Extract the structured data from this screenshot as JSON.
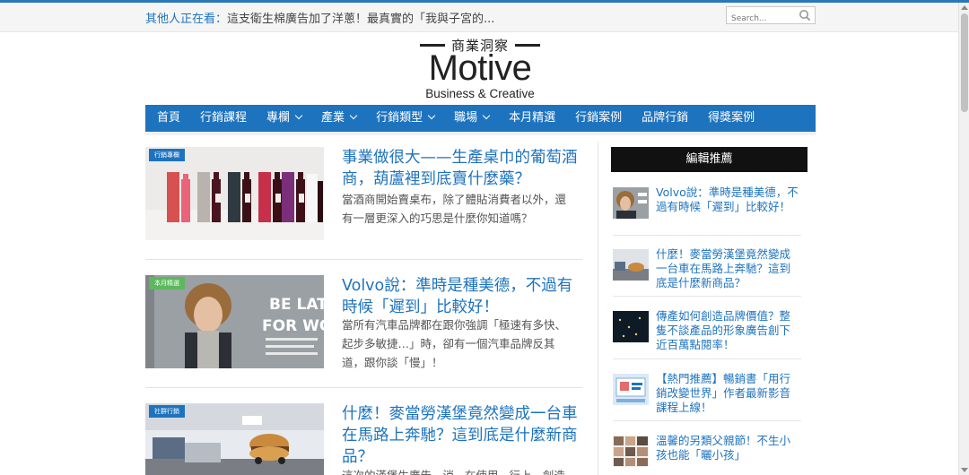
{
  "ticker": {
    "lead": "其他人正在看：",
    "text": "這支衛生棉廣告加了洋蔥！最真實的「我與子宮的..."
  },
  "search": {
    "placeholder": "Search..."
  },
  "logo": {
    "chinese": "商業洞察",
    "main": "Motive",
    "sub": "Business & Creative"
  },
  "nav": [
    {
      "label": "首頁",
      "dropdown": false
    },
    {
      "label": "行銷課程",
      "dropdown": false
    },
    {
      "label": "專欄",
      "dropdown": true
    },
    {
      "label": "產業",
      "dropdown": true
    },
    {
      "label": "行銷類型",
      "dropdown": true
    },
    {
      "label": "職場",
      "dropdown": true
    },
    {
      "label": "本月精選",
      "dropdown": false
    },
    {
      "label": "行銷案例",
      "dropdown": false
    },
    {
      "label": "品牌行銷",
      "dropdown": false
    },
    {
      "label": "得獎案例",
      "dropdown": false
    }
  ],
  "articles": [
    {
      "tag": "行銷專欄",
      "tag_color": "#1e73be",
      "title": "事業做很大——生產桌巾的葡萄酒商，葫蘆裡到底賣什麼藥？",
      "excerpt": "當酒商開始賣桌布，除了體貼消費者以外，還有一層更深入的巧思是什麼你知道嗎？"
    },
    {
      "tag": "本月精選",
      "tag_color": "#5cb85c",
      "title": "Volvo說：準時是種美德，不過有時候「遲到」比較好！",
      "excerpt": "當所有汽車品牌都在跟你強調「極速有多快、起步多敏捷…」時，卻有一個汽車品牌反其道，跟你談「慢」！",
      "image_text": [
        "BE LATE",
        "FOR WOR"
      ]
    },
    {
      "tag": "社群行銷",
      "tag_color": "#1e73be",
      "title": "什麼！麥當勞漢堡竟然變成一台車在馬路上奔馳？這到底是什麼新商品？",
      "excerpt": "這次的漢堡生廣告，消...在使用...行上，創造..."
    }
  ],
  "sidebar": {
    "heading": "編輯推薦",
    "items": [
      {
        "title": "Volvo說：準時是種美德，不過有時候「遲到」比較好！"
      },
      {
        "title": "什麼！麥當勞漢堡竟然變成一台車在馬路上奔馳？這到底是什麼新商品？"
      },
      {
        "title": "傳產如何創造品牌價值？整隻不談產品的形象廣告創下近百萬點閱率！"
      },
      {
        "title": "【熱門推薦】暢銷書「用行銷改變世界」作者最新影音課程上線！"
      },
      {
        "title": "溫馨的另類父親節！不生小孩也能「曬小孩」"
      }
    ]
  },
  "colors": {
    "accent": "#1e73be",
    "nav_bg": "#1e73be",
    "sidebar_head_bg": "#111111",
    "tag_green": "#5cb85c"
  }
}
